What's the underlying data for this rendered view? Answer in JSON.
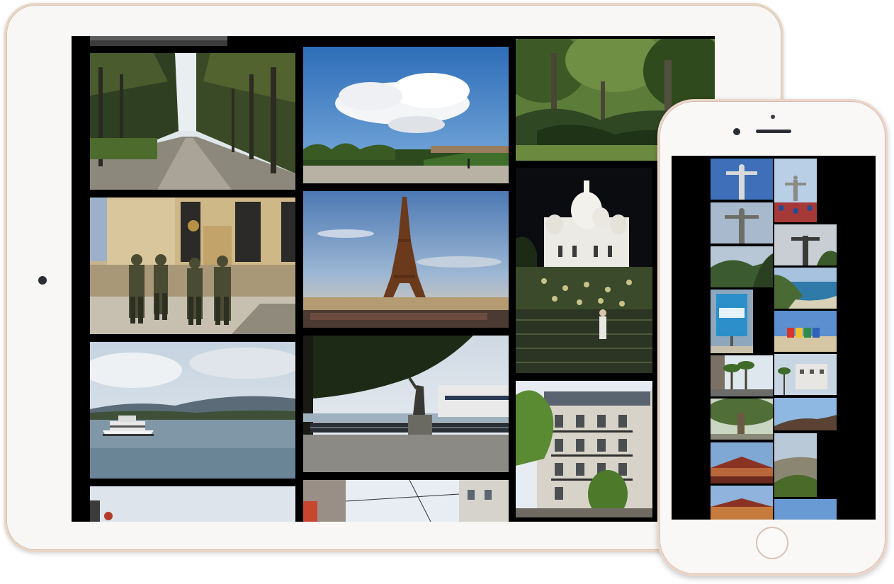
{
  "tablet": {
    "name": "iPad",
    "content": "photo-grid",
    "photos": [
      {
        "name": "tree-lined-path",
        "icon": "photo-thumbnail"
      },
      {
        "name": "clouds-over-park",
        "icon": "photo-thumbnail"
      },
      {
        "name": "forest-garden",
        "icon": "photo-thumbnail"
      },
      {
        "name": "soldiers-trocadero",
        "icon": "photo-thumbnail"
      },
      {
        "name": "eiffel-tower",
        "icon": "photo-thumbnail"
      },
      {
        "name": "sacre-coeur-night",
        "icon": "photo-thumbnail"
      },
      {
        "name": "lake-boat",
        "icon": "photo-thumbnail"
      },
      {
        "name": "lakeside-statue",
        "icon": "photo-thumbnail"
      },
      {
        "name": "haussmann-building",
        "icon": "photo-thumbnail"
      },
      {
        "name": "sky-bottom-left",
        "icon": "photo-thumbnail"
      },
      {
        "name": "street-bottom-middle",
        "icon": "photo-thumbnail"
      }
    ]
  },
  "phone": {
    "name": "iPhone",
    "content": "photo-grid",
    "photos": [
      {
        "name": "christ-redeemer-1"
      },
      {
        "name": "christ-redeemer-crowd"
      },
      {
        "name": "christ-redeemer-2"
      },
      {
        "name": "christ-redeemer-3"
      },
      {
        "name": "mountain-view"
      },
      {
        "name": "coastline"
      },
      {
        "name": "shark-sign"
      },
      {
        "name": "beach-huts"
      },
      {
        "name": "palm-street"
      },
      {
        "name": "palm-building"
      },
      {
        "name": "big-tree"
      },
      {
        "name": "rocky-hill"
      },
      {
        "name": "temple-roof"
      },
      {
        "name": "city-hills"
      },
      {
        "name": "temple-roof-2"
      },
      {
        "name": "sky-thumb"
      }
    ]
  },
  "colors": {
    "tablet_frame": "#f8f7f5",
    "tablet_border": "#e8d6c6",
    "phone_frame": "#f9f8f6",
    "phone_border": "#ecd5c9",
    "screen_bg": "#000000"
  }
}
